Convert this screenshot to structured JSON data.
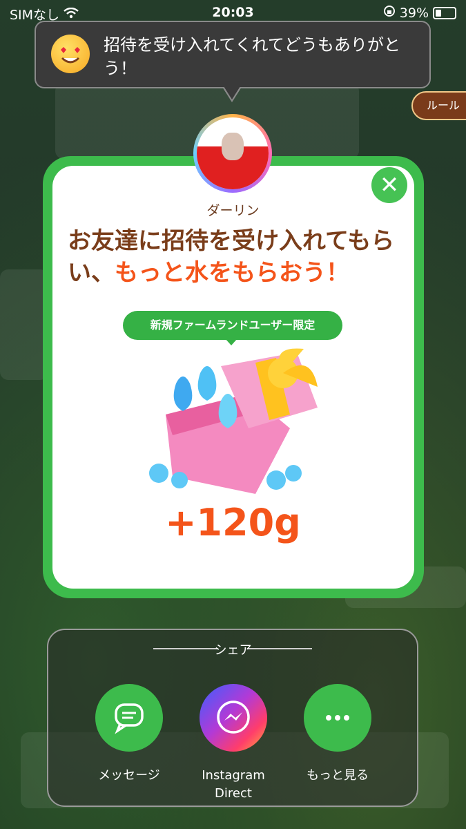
{
  "status_bar": {
    "carrier": "SIMなし",
    "time": "20:03",
    "battery": "39%"
  },
  "toast": {
    "message": "招待を受け入れてくれてどうもありがとう！"
  },
  "rule_button": "ルール",
  "modal": {
    "user_name": "ダーリン",
    "headline_part1": "お友達に招待を受け入れてもらい、",
    "headline_part2": "もっと水をもらおう！",
    "tag": "新規ファームランドユーザー限定",
    "reward": "+120g"
  },
  "share": {
    "title": "シェア",
    "buttons": [
      {
        "label": "メッセージ"
      },
      {
        "label": "Instagram\nDirect"
      },
      {
        "label": "もっと見る"
      }
    ]
  },
  "colors": {
    "green": "#3dbb4c",
    "orange": "#f4541a",
    "brown": "#7a3d1a"
  }
}
